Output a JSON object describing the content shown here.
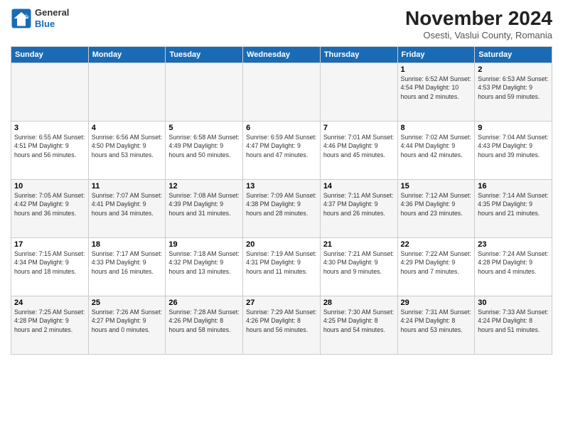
{
  "logo": {
    "general": "General",
    "blue": "Blue"
  },
  "title": "November 2024",
  "subtitle": "Osesti, Vaslui County, Romania",
  "days_of_week": [
    "Sunday",
    "Monday",
    "Tuesday",
    "Wednesday",
    "Thursday",
    "Friday",
    "Saturday"
  ],
  "weeks": [
    {
      "row_class": "row-odd",
      "days": [
        {
          "num": "",
          "info": ""
        },
        {
          "num": "",
          "info": ""
        },
        {
          "num": "",
          "info": ""
        },
        {
          "num": "",
          "info": ""
        },
        {
          "num": "",
          "info": ""
        },
        {
          "num": "1",
          "info": "Sunrise: 6:52 AM\nSunset: 4:54 PM\nDaylight: 10 hours\nand 2 minutes."
        },
        {
          "num": "2",
          "info": "Sunrise: 6:53 AM\nSunset: 4:53 PM\nDaylight: 9 hours\nand 59 minutes."
        }
      ]
    },
    {
      "row_class": "row-even",
      "days": [
        {
          "num": "3",
          "info": "Sunrise: 6:55 AM\nSunset: 4:51 PM\nDaylight: 9 hours\nand 56 minutes."
        },
        {
          "num": "4",
          "info": "Sunrise: 6:56 AM\nSunset: 4:50 PM\nDaylight: 9 hours\nand 53 minutes."
        },
        {
          "num": "5",
          "info": "Sunrise: 6:58 AM\nSunset: 4:49 PM\nDaylight: 9 hours\nand 50 minutes."
        },
        {
          "num": "6",
          "info": "Sunrise: 6:59 AM\nSunset: 4:47 PM\nDaylight: 9 hours\nand 47 minutes."
        },
        {
          "num": "7",
          "info": "Sunrise: 7:01 AM\nSunset: 4:46 PM\nDaylight: 9 hours\nand 45 minutes."
        },
        {
          "num": "8",
          "info": "Sunrise: 7:02 AM\nSunset: 4:44 PM\nDaylight: 9 hours\nand 42 minutes."
        },
        {
          "num": "9",
          "info": "Sunrise: 7:04 AM\nSunset: 4:43 PM\nDaylight: 9 hours\nand 39 minutes."
        }
      ]
    },
    {
      "row_class": "row-odd",
      "days": [
        {
          "num": "10",
          "info": "Sunrise: 7:05 AM\nSunset: 4:42 PM\nDaylight: 9 hours\nand 36 minutes."
        },
        {
          "num": "11",
          "info": "Sunrise: 7:07 AM\nSunset: 4:41 PM\nDaylight: 9 hours\nand 34 minutes."
        },
        {
          "num": "12",
          "info": "Sunrise: 7:08 AM\nSunset: 4:39 PM\nDaylight: 9 hours\nand 31 minutes."
        },
        {
          "num": "13",
          "info": "Sunrise: 7:09 AM\nSunset: 4:38 PM\nDaylight: 9 hours\nand 28 minutes."
        },
        {
          "num": "14",
          "info": "Sunrise: 7:11 AM\nSunset: 4:37 PM\nDaylight: 9 hours\nand 26 minutes."
        },
        {
          "num": "15",
          "info": "Sunrise: 7:12 AM\nSunset: 4:36 PM\nDaylight: 9 hours\nand 23 minutes."
        },
        {
          "num": "16",
          "info": "Sunrise: 7:14 AM\nSunset: 4:35 PM\nDaylight: 9 hours\nand 21 minutes."
        }
      ]
    },
    {
      "row_class": "row-even",
      "days": [
        {
          "num": "17",
          "info": "Sunrise: 7:15 AM\nSunset: 4:34 PM\nDaylight: 9 hours\nand 18 minutes."
        },
        {
          "num": "18",
          "info": "Sunrise: 7:17 AM\nSunset: 4:33 PM\nDaylight: 9 hours\nand 16 minutes."
        },
        {
          "num": "19",
          "info": "Sunrise: 7:18 AM\nSunset: 4:32 PM\nDaylight: 9 hours\nand 13 minutes."
        },
        {
          "num": "20",
          "info": "Sunrise: 7:19 AM\nSunset: 4:31 PM\nDaylight: 9 hours\nand 11 minutes."
        },
        {
          "num": "21",
          "info": "Sunrise: 7:21 AM\nSunset: 4:30 PM\nDaylight: 9 hours\nand 9 minutes."
        },
        {
          "num": "22",
          "info": "Sunrise: 7:22 AM\nSunset: 4:29 PM\nDaylight: 9 hours\nand 7 minutes."
        },
        {
          "num": "23",
          "info": "Sunrise: 7:24 AM\nSunset: 4:28 PM\nDaylight: 9 hours\nand 4 minutes."
        }
      ]
    },
    {
      "row_class": "row-odd",
      "days": [
        {
          "num": "24",
          "info": "Sunrise: 7:25 AM\nSunset: 4:28 PM\nDaylight: 9 hours\nand 2 minutes."
        },
        {
          "num": "25",
          "info": "Sunrise: 7:26 AM\nSunset: 4:27 PM\nDaylight: 9 hours\nand 0 minutes."
        },
        {
          "num": "26",
          "info": "Sunrise: 7:28 AM\nSunset: 4:26 PM\nDaylight: 8 hours\nand 58 minutes."
        },
        {
          "num": "27",
          "info": "Sunrise: 7:29 AM\nSunset: 4:26 PM\nDaylight: 8 hours\nand 56 minutes."
        },
        {
          "num": "28",
          "info": "Sunrise: 7:30 AM\nSunset: 4:25 PM\nDaylight: 8 hours\nand 54 minutes."
        },
        {
          "num": "29",
          "info": "Sunrise: 7:31 AM\nSunset: 4:24 PM\nDaylight: 8 hours\nand 53 minutes."
        },
        {
          "num": "30",
          "info": "Sunrise: 7:33 AM\nSunset: 4:24 PM\nDaylight: 8 hours\nand 51 minutes."
        }
      ]
    }
  ]
}
